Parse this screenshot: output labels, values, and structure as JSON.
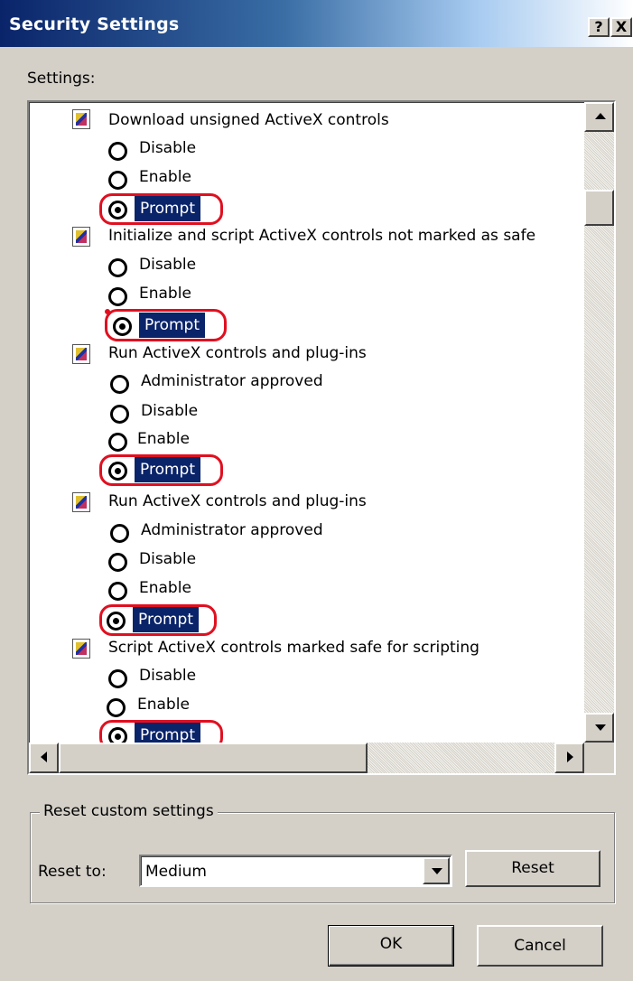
{
  "window": {
    "title": "Security Settings",
    "help_button": "?",
    "close_button": "X"
  },
  "settings_label": "Settings:",
  "groups": [
    {
      "label": "Download unsigned ActiveX controls",
      "options": [
        "Disable",
        "Enable",
        "Prompt"
      ],
      "selected": "Prompt"
    },
    {
      "label": "Initialize and script ActiveX controls not marked as safe",
      "options": [
        "Disable",
        "Enable",
        "Prompt"
      ],
      "selected": "Prompt"
    },
    {
      "label": "Run ActiveX controls and plug-ins",
      "options": [
        "Administrator approved",
        "Disable",
        "Enable",
        "Prompt"
      ],
      "selected": "Prompt"
    },
    {
      "label": "Run ActiveX controls and plug-ins",
      "options": [
        "Administrator approved",
        "Disable",
        "Enable",
        "Prompt"
      ],
      "selected": "Prompt"
    },
    {
      "label": "Script ActiveX controls marked safe for scripting",
      "options": [
        "Disable",
        "Enable",
        "Prompt"
      ],
      "selected": "Prompt"
    }
  ],
  "reset_group": {
    "legend": "Reset custom settings",
    "reset_to_label": "Reset to:",
    "reset_to_value": "Medium",
    "reset_button": "Reset"
  },
  "footer": {
    "ok_label": "OK",
    "cancel_label": "Cancel"
  },
  "colors": {
    "dialog_face": "#d4d0c8",
    "title_bar_start": "#0a246a",
    "selection_highlight": "#0a246a",
    "annotation_red": "#e01020"
  }
}
